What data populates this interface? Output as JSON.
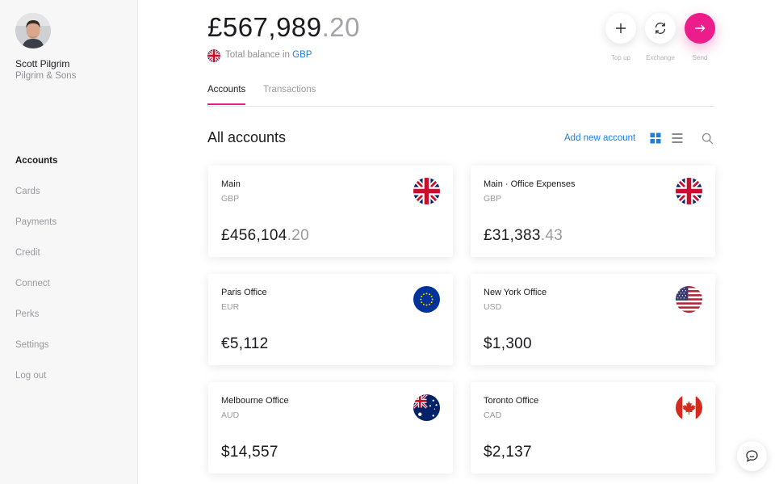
{
  "user": {
    "name": "Scott Pilgrim",
    "company": "Pilgrim & Sons"
  },
  "nav": [
    {
      "label": "Accounts",
      "active": true
    },
    {
      "label": "Cards"
    },
    {
      "label": "Payments"
    },
    {
      "label": "Credit"
    },
    {
      "label": "Connect"
    },
    {
      "label": "Perks"
    },
    {
      "label": "Settings"
    },
    {
      "label": "Log out"
    }
  ],
  "balance": {
    "main": "£567,989",
    "decimal": ".20",
    "label": "Total balance in",
    "currency": "GBP"
  },
  "actions": {
    "top_up": "Top up",
    "exchange": "Exchange",
    "send": "Send"
  },
  "tabs": [
    "Accounts",
    "Transactions"
  ],
  "section": {
    "title": "All accounts",
    "add_link": "Add new account"
  },
  "accounts": [
    {
      "name": "Main",
      "currency": "GBP",
      "amount": "£456,104",
      "decimal": ".20",
      "flag": "uk-flag-icon"
    },
    {
      "name": "Main · Office Expenses",
      "currency": "GBP",
      "amount": "£31,383",
      "decimal": ".43",
      "flag": "uk-flag-icon"
    },
    {
      "name": "Paris Office",
      "currency": "EUR",
      "amount": "€5,112",
      "decimal": "",
      "flag": "eu-flag-icon"
    },
    {
      "name": "New York Office",
      "currency": "USD",
      "amount": "$1,300",
      "decimal": "",
      "flag": "us-flag-icon"
    },
    {
      "name": "Melbourne Office",
      "currency": "AUD",
      "amount": "$14,557",
      "decimal": "",
      "flag": "au-flag-icon"
    },
    {
      "name": "Toronto Office",
      "currency": "CAD",
      "amount": "$2,137",
      "decimal": "",
      "flag": "ca-flag-icon"
    }
  ],
  "colors": {
    "accent": "#ec1c8a",
    "link": "#1c7fe0",
    "grid_active": "#1c7fe0"
  }
}
